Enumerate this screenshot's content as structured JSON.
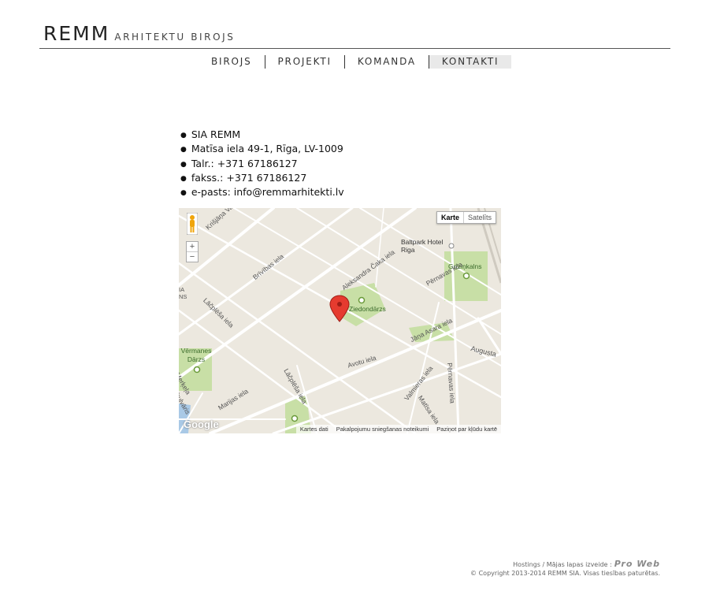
{
  "header": {
    "logo_big": "REMM",
    "logo_small": "ARHITEKTU BIROJS"
  },
  "nav": {
    "items": [
      {
        "label": "BIROJS",
        "active": false
      },
      {
        "label": "PROJEKTI",
        "active": false
      },
      {
        "label": "KOMANDA",
        "active": false
      },
      {
        "label": "KONTAKTI",
        "active": true
      }
    ]
  },
  "contact": {
    "company": "SIA REMM",
    "address": "Matīsa iela 49-1, Rīga, LV-1009",
    "phone": "Talr.: +371 67186127",
    "fax": "fakss.: +371 67186127",
    "email": "e-pasts: info@remmarhitekti.lv"
  },
  "map": {
    "type_buttons": [
      "Karte",
      "Satelīts"
    ],
    "zoom_in": "+",
    "zoom_out": "−",
    "labels": {
      "krisjana": "Krišjāņa Valdem...",
      "brivibas": "Brīvības iela",
      "aleksandra": "Aleksandra Čaka iela",
      "lacplesa1": "Lāčplēša iela",
      "lacplesa2": "Lāčplēša iela",
      "baltpark": "Baltpark Hotel Riga",
      "griziņkalns": "Grīziņkalns",
      "ziedondarzs": "Ziedondārzs",
      "vermanes": "Vērmanes Dārzs",
      "avotu": "Avotu iela",
      "augusta": "Augusta",
      "jana_asara": "Jāņa Asara iela",
      "pernavas1": "Pērnavas iela",
      "pernavas2": "Pērnavas iela",
      "marijas": "Marijas iela",
      "valmieras": "Valmieras iela",
      "matisa": "Matīsa iela",
      "merkela": "Merķeļa",
      "bulvaris": "bulvāris",
      "ias": "IA\nNS"
    },
    "google_mark": "Google",
    "attribution": [
      "Kartes dati",
      "Pakalpojumu sniegšanas noteikumi",
      "Paziņot par kļūdu kartē"
    ]
  },
  "footer": {
    "line1_prefix": "Hostings / Mājas lapas izveide :",
    "brand": "Pro Web",
    "line2": "© Copyright 2013-2014 REMM SIA. Visas tiesības paturētas."
  }
}
